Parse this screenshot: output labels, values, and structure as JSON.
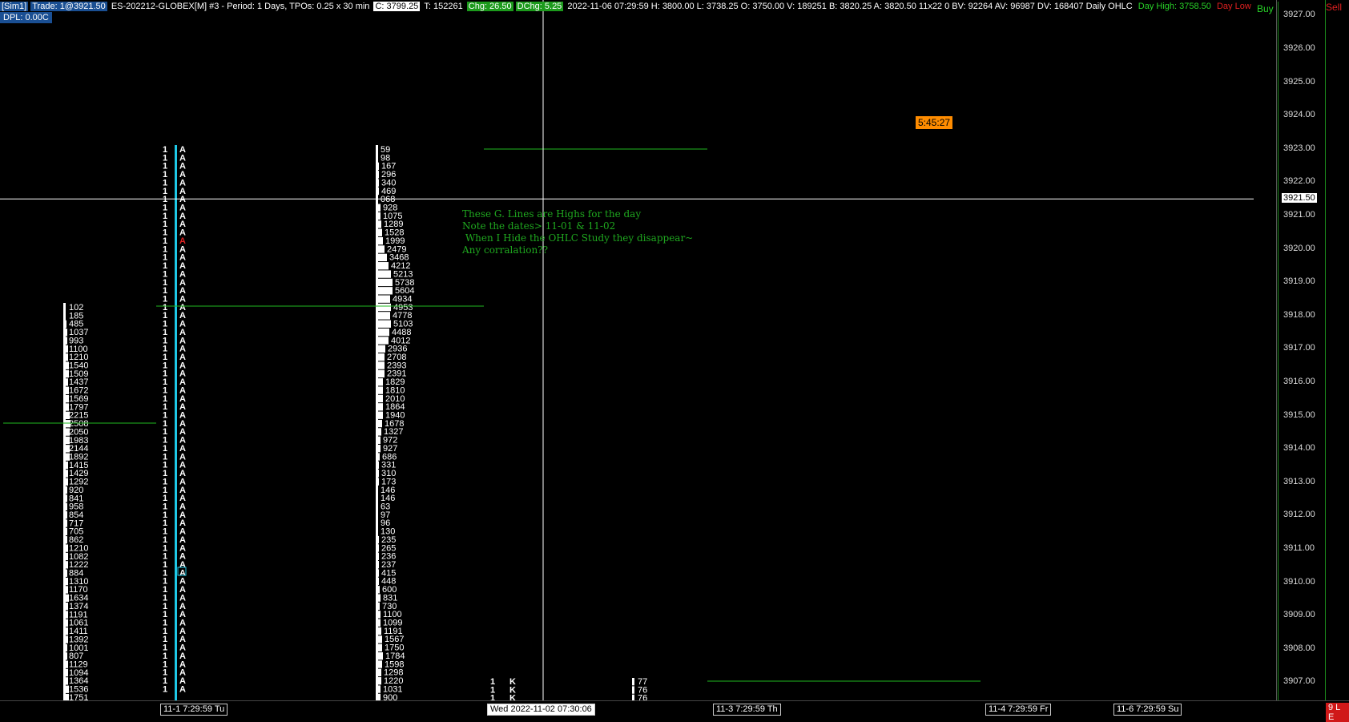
{
  "header": {
    "sim": "[Sim1]",
    "trade": "Trade: 1@3921.50",
    "symbol": "ES-202212-GLOBEX[M]  #3 - Period: 1 Days, TPOs: 0.25 x 30 min",
    "close": "C: 3799.25",
    "ticks": "T: 152261",
    "chg": "Chg: 26.50",
    "dchg": "DChg: 5.25",
    "stats": "2022-11-06 07:29:59 H: 3800.00 L: 3738.25 O: 3750.00 V: 189251 B: 3820.25 A: 3820.50 11x22 0 BV: 92264 AV: 96987 DV: 168407 Daily OHLC",
    "day_high": "Day High: 3758.50",
    "day_low": "Day Low"
  },
  "dpl": "DPL: 0.00C",
  "buy_label": "Buy",
  "sell_label": "Sell",
  "timer": "5:45:27",
  "note": "These G. Lines are Highs for the day\nNote the dates> 11-01 & 11-02\n When I Hide the OHLC Study they disappear~\nAny corralation??",
  "price_axis": {
    "ticks": [
      "3927.00",
      "3926.00",
      "3925.00",
      "3924.00",
      "3923.00",
      "3922.00",
      "3921.00",
      "3920.00",
      "3919.00",
      "3918.00",
      "3917.00",
      "3916.00",
      "3915.00",
      "3914.00",
      "3913.00",
      "3912.00",
      "3911.00",
      "3910.00",
      "3909.00",
      "3908.00",
      "3907.00"
    ],
    "current": "3921.50"
  },
  "time_axis": [
    {
      "label": "11-1  7:29:59 Tu",
      "cross": false
    },
    {
      "label": "Wed 2022-11-02  07:30:06",
      "cross": true
    },
    {
      "label": "11-3  7:29:59 Th",
      "cross": false
    },
    {
      "label": "11-4  7:29:59 Fr",
      "cross": false
    },
    {
      "label": "11-6  7:29:59 Su",
      "cross": false
    }
  ],
  "badge": "9 L E",
  "profiles": {
    "left_volumes": [
      "102",
      "185",
      "485",
      "1037",
      "993",
      "1100",
      "1210",
      "1540",
      "1509",
      "1437",
      "1672",
      "1569",
      "1797",
      "2215",
      "2508",
      "2050",
      "1983",
      "2144",
      "1892",
      "1415",
      "1429",
      "1292",
      "920",
      "841",
      "958",
      "854",
      "717",
      "705",
      "862",
      "1210",
      "1082",
      "1222",
      "884",
      "1310",
      "1170",
      "1634",
      "1374",
      "1191",
      "1061",
      "1411",
      "1392",
      "1001",
      "807",
      "1129",
      "1094",
      "1364",
      "1536",
      "1751"
    ],
    "mid_volumes": [
      "59",
      "98",
      "167",
      "296",
      "340",
      "469",
      "068",
      "928",
      "1075",
      "1289",
      "1528",
      "1999",
      "2479",
      "3468",
      "4212",
      "5213",
      "5738",
      "5604",
      "4934",
      "4953",
      "4778",
      "5103",
      "4488",
      "4012",
      "2936",
      "2708",
      "2393",
      "2391",
      "1829",
      "1810",
      "2010",
      "1864",
      "1940",
      "1678",
      "1327",
      "972",
      "927",
      "686",
      "331",
      "310",
      "173",
      "146",
      "146",
      "63",
      "97",
      "96",
      "130",
      "235",
      "265",
      "236",
      "237",
      "415",
      "448",
      "600",
      "831",
      "730",
      "1100",
      "1099",
      "1191",
      "1567",
      "1750",
      "1784",
      "1598",
      "1298",
      "1220",
      "1031",
      "900"
    ],
    "right_volumes": [
      "77",
      "76",
      "76"
    ],
    "tpo_letter": "A",
    "tpo_count": "1",
    "k_letter": "K"
  }
}
